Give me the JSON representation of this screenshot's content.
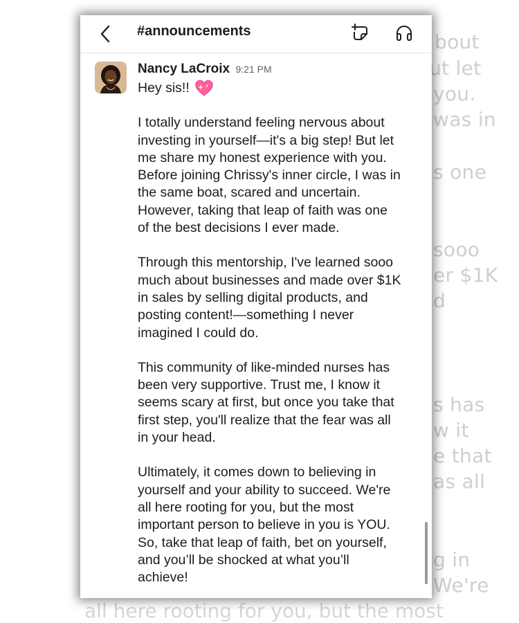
{
  "background_echo": {
    "right_lines": [
      "bout",
      "ut let",
      "you.",
      "was in",
      "s one",
      "sooo",
      "er $1K",
      "d",
      "s has",
      "w it",
      "e that",
      "as all",
      "g in",
      "We're"
    ],
    "bottom_line": "all here rooting for you, but the most"
  },
  "header": {
    "channel": "#announcements",
    "icons": [
      "back-chevron-icon",
      "canvas-icon",
      "headphones-icon"
    ]
  },
  "message": {
    "author": "Nancy LaCroix",
    "time": "9:21 PM",
    "greeting": "Hey sis!!",
    "emoji": "sparkling-heart-icon",
    "paragraphs": [
      "I totally understand feeling nervous about\ninvesting in yourself—it's a big step! But let\nme share my honest experience with you.\nBefore joining Chrissy's inner circle, I was in\nthe same boat, scared and uncertain.\nHowever, taking that leap of faith was one\nof the best decisions I ever made.",
      "Through this mentorship, I've learned sooo\nmuch about businesses and made over $1K\nin sales by selling digital products, and\nposting content!—something I never\nimagined I could do.",
      "This community of like-minded nurses has\nbeen very supportive. Trust me, I know it\nseems scary at first, but once you take that\nfirst step, you'll realize that the fear was all\nin your head.",
      "Ultimately, it comes down to believing in\nyourself and your ability to succeed. We're\nall here rooting for you, but the most\nimportant person to believe in you is YOU.\nSo, take that leap of faith, bet on yourself,\nand you’ll be shocked at what you’ll\nachieve!"
    ]
  },
  "colors": {
    "text": "#1d1c1d",
    "muted": "#616061",
    "echo": "#cfcfcf",
    "heart": "#ff5fa2"
  }
}
